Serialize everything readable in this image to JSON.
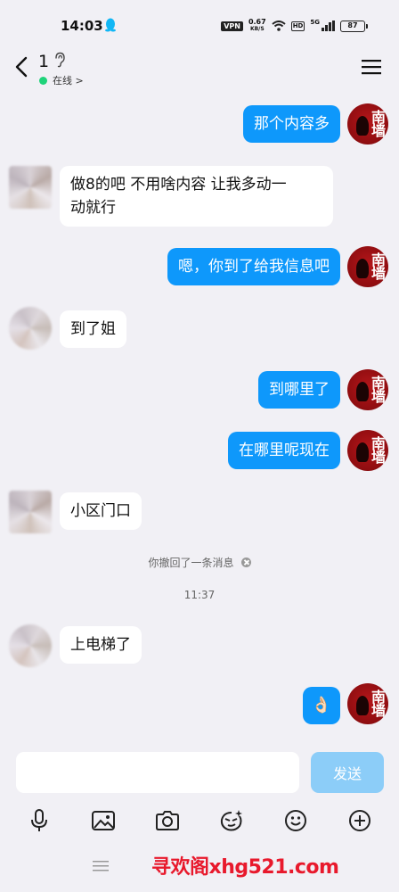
{
  "status_bar": {
    "time": "14:03",
    "vpn": "VPN",
    "speed_value": "0.67",
    "speed_unit": "KB/S",
    "hd": "HD",
    "network": "5G",
    "battery": "87"
  },
  "header": {
    "title": "1",
    "presence": "在线 >"
  },
  "messages": {
    "m1": "那个内容多",
    "m2": "做8的吧 不用啥内容 让我多动一\n动就行",
    "m3": "嗯，你到了给我信息吧",
    "m4": "到了姐",
    "m5": "到哪里了",
    "m6": "在哪里呢现在",
    "m7": "小区门口",
    "recall_notice": "你撤回了一条消息",
    "time_divider": "11:37",
    "m8": "上电梯了",
    "m9_emoji": "👌🏻"
  },
  "avatar_me_text": "南墙",
  "composer": {
    "input_value": "",
    "send_label": "发送"
  },
  "watermark": "寻欢阁xhg521.com",
  "colors": {
    "outgoing_bubble": "#0e98fb",
    "incoming_bubble": "#ffffff",
    "background": "#f1f0f5",
    "send_button": "#8ccdf8",
    "online_dot": "#1fd37a",
    "watermark": "#e8192c"
  },
  "icons": [
    "qq-penguin-icon",
    "ear-icon",
    "back-icon",
    "menu-icon",
    "microphone-icon",
    "image-icon",
    "camera-icon",
    "sticker-icon",
    "emoji-icon",
    "plus-icon",
    "nav-menu-icon"
  ]
}
